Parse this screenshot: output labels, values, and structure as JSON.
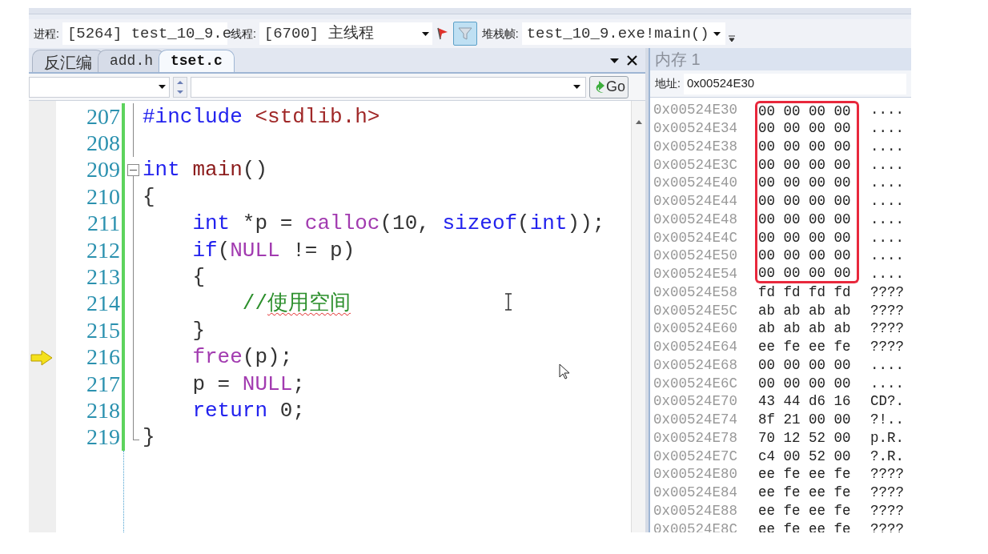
{
  "toolbar": {
    "process_label": "进程:",
    "process": "[5264] test_10_9.e",
    "thread_label": "线程:",
    "thread": "[6700] 主线程",
    "filter_pressed": true,
    "stack_label": "堆栈帧:",
    "stack_frame": "test_10_9.exe!main()"
  },
  "tabs": [
    {
      "label": "反汇编",
      "selected": false
    },
    {
      "label": "add.h",
      "selected": false
    },
    {
      "label": "tset.c",
      "selected": true
    }
  ],
  "editor": {
    "go_button": "Go",
    "lines": [
      {
        "number": "207",
        "current": false,
        "segments": [
          {
            "kind": "keyword",
            "text": "#include "
          },
          {
            "kind": "include",
            "text": "<stdlib.h>"
          }
        ]
      },
      {
        "number": "208",
        "current": false
      },
      {
        "number": "209",
        "expanded": true,
        "current": false,
        "segments": [
          {
            "kind": "keyword",
            "text": "int "
          },
          {
            "kind": "name",
            "text": "main"
          },
          {
            "kind": "plain",
            "text": "()"
          }
        ]
      },
      {
        "number": "210",
        "current": false,
        "segments": [
          {
            "kind": "plain",
            "text": "{"
          }
        ]
      },
      {
        "number": "211",
        "current": false,
        "segments": [
          {
            "kind": "keyword",
            "text": "    int "
          },
          {
            "kind": "plain",
            "text": "*p = "
          },
          {
            "kind": "func",
            "text": "calloc"
          },
          {
            "kind": "plain",
            "text": "(10, "
          },
          {
            "kind": "keyword",
            "text": "sizeof"
          },
          {
            "kind": "plain",
            "text": "("
          },
          {
            "kind": "keyword",
            "text": "int"
          },
          {
            "kind": "plain",
            "text": "));"
          }
        ]
      },
      {
        "number": "212",
        "current": false,
        "segments": [
          {
            "kind": "keyword",
            "text": "    if"
          },
          {
            "kind": "plain",
            "text": "("
          },
          {
            "kind": "func",
            "text": "NULL"
          },
          {
            "kind": "plain",
            "text": " != p)"
          }
        ]
      },
      {
        "number": "213",
        "current": false,
        "segments": [
          {
            "kind": "plain",
            "text": "    {"
          }
        ]
      },
      {
        "number": "214",
        "current": false,
        "segments": [
          {
            "kind": "comment",
            "text": "        //"
          },
          {
            "kind": "comment_flagged",
            "text": "使用空间"
          }
        ]
      },
      {
        "number": "215",
        "current": false,
        "segments": [
          {
            "kind": "plain",
            "text": "    }"
          }
        ]
      },
      {
        "number": "216",
        "current": true,
        "segments": [
          {
            "kind": "func",
            "text": "    free"
          },
          {
            "kind": "plain",
            "text": "(p);"
          }
        ]
      },
      {
        "number": "217",
        "current": false,
        "segments": [
          {
            "kind": "plain",
            "text": "    p = "
          },
          {
            "kind": "func",
            "text": "NULL"
          },
          {
            "kind": "plain",
            "text": ";"
          }
        ]
      },
      {
        "number": "218",
        "current": false,
        "segments": [
          {
            "kind": "keyword",
            "text": "    return "
          },
          {
            "kind": "plain",
            "text": "0;"
          }
        ]
      },
      {
        "number": "219",
        "current": false,
        "segments": [
          {
            "kind": "plain",
            "text": "}"
          }
        ]
      }
    ]
  },
  "memory": {
    "title": "内存 1",
    "address_label": "地址:",
    "address": "0x00524E30",
    "rows": [
      {
        "address": "0x00524E30",
        "bytes": [
          "00",
          "00",
          "00",
          "00"
        ],
        "ascii": "....",
        "highlighted": true
      },
      {
        "address": "0x00524E34",
        "bytes": [
          "00",
          "00",
          "00",
          "00"
        ],
        "ascii": "....",
        "highlighted": true
      },
      {
        "address": "0x00524E38",
        "bytes": [
          "00",
          "00",
          "00",
          "00"
        ],
        "ascii": "....",
        "highlighted": true
      },
      {
        "address": "0x00524E3C",
        "bytes": [
          "00",
          "00",
          "00",
          "00"
        ],
        "ascii": "....",
        "highlighted": true
      },
      {
        "address": "0x00524E40",
        "bytes": [
          "00",
          "00",
          "00",
          "00"
        ],
        "ascii": "....",
        "highlighted": true
      },
      {
        "address": "0x00524E44",
        "bytes": [
          "00",
          "00",
          "00",
          "00"
        ],
        "ascii": "....",
        "highlighted": true
      },
      {
        "address": "0x00524E48",
        "bytes": [
          "00",
          "00",
          "00",
          "00"
        ],
        "ascii": "....",
        "highlighted": true
      },
      {
        "address": "0x00524E4C",
        "bytes": [
          "00",
          "00",
          "00",
          "00"
        ],
        "ascii": "....",
        "highlighted": true
      },
      {
        "address": "0x00524E50",
        "bytes": [
          "00",
          "00",
          "00",
          "00"
        ],
        "ascii": "....",
        "highlighted": true
      },
      {
        "address": "0x00524E54",
        "bytes": [
          "00",
          "00",
          "00",
          "00"
        ],
        "ascii": "....",
        "highlighted": true
      },
      {
        "address": "0x00524E58",
        "bytes": [
          "fd",
          "fd",
          "fd",
          "fd"
        ],
        "ascii": "????",
        "highlighted": false
      },
      {
        "address": "0x00524E5C",
        "bytes": [
          "ab",
          "ab",
          "ab",
          "ab"
        ],
        "ascii": "????",
        "highlighted": false
      },
      {
        "address": "0x00524E60",
        "bytes": [
          "ab",
          "ab",
          "ab",
          "ab"
        ],
        "ascii": "????",
        "highlighted": false
      },
      {
        "address": "0x00524E64",
        "bytes": [
          "ee",
          "fe",
          "ee",
          "fe"
        ],
        "ascii": "????",
        "highlighted": false
      },
      {
        "address": "0x00524E68",
        "bytes": [
          "00",
          "00",
          "00",
          "00"
        ],
        "ascii": "....",
        "highlighted": false
      },
      {
        "address": "0x00524E6C",
        "bytes": [
          "00",
          "00",
          "00",
          "00"
        ],
        "ascii": "....",
        "highlighted": false
      },
      {
        "address": "0x00524E70",
        "bytes": [
          "43",
          "44",
          "d6",
          "16"
        ],
        "ascii": "CD?.",
        "highlighted": false
      },
      {
        "address": "0x00524E74",
        "bytes": [
          "8f",
          "21",
          "00",
          "00"
        ],
        "ascii": "?!..",
        "highlighted": false
      },
      {
        "address": "0x00524E78",
        "bytes": [
          "70",
          "12",
          "52",
          "00"
        ],
        "ascii": "p.R.",
        "highlighted": false
      },
      {
        "address": "0x00524E7C",
        "bytes": [
          "c4",
          "00",
          "52",
          "00"
        ],
        "ascii": "?.R.",
        "highlighted": false
      },
      {
        "address": "0x00524E80",
        "bytes": [
          "ee",
          "fe",
          "ee",
          "fe"
        ],
        "ascii": "????",
        "highlighted": false
      },
      {
        "address": "0x00524E84",
        "bytes": [
          "ee",
          "fe",
          "ee",
          "fe"
        ],
        "ascii": "????",
        "highlighted": false
      },
      {
        "address": "0x00524E88",
        "bytes": [
          "ee",
          "fe",
          "ee",
          "fe"
        ],
        "ascii": "????",
        "highlighted": false
      },
      {
        "address": "0x00524E8C",
        "bytes": [
          "ee",
          "fe",
          "ee",
          "fe"
        ],
        "ascii": "????",
        "highlighted": false
      }
    ]
  }
}
